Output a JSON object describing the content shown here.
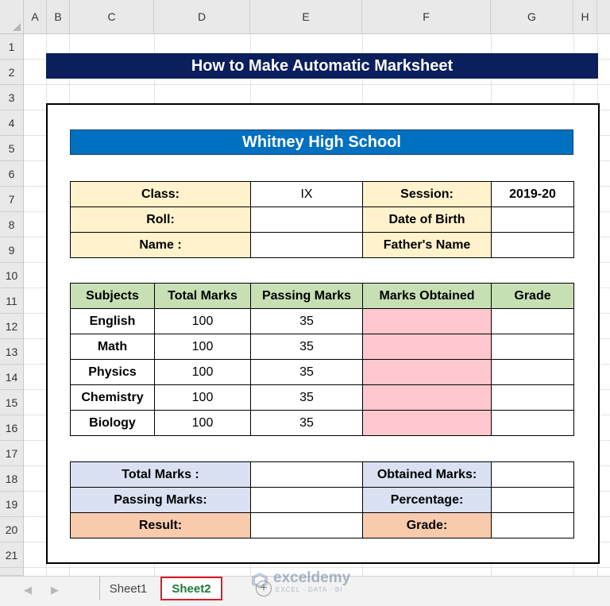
{
  "columns": [
    "A",
    "B",
    "C",
    "D",
    "E",
    "F",
    "G",
    "H"
  ],
  "rows": [
    "1",
    "2",
    "3",
    "4",
    "5",
    "6",
    "7",
    "8",
    "9",
    "10",
    "11",
    "12",
    "13",
    "14",
    "15",
    "16",
    "17",
    "18",
    "19",
    "20",
    "21"
  ],
  "title": "How to Make Automatic Marksheet",
  "school": "Whitney High School",
  "info": {
    "class_label": "Class:",
    "class_value": "IX",
    "session_label": "Session:",
    "session_value": "2019-20",
    "roll_label": "Roll:",
    "roll_value": "",
    "dob_label": "Date of Birth",
    "dob_value": "",
    "name_label": "Name :",
    "name_value": "",
    "father_label": "Father's Name",
    "father_value": ""
  },
  "marks": {
    "headers": [
      "Subjects",
      "Total Marks",
      "Passing Marks",
      "Marks Obtained",
      "Grade"
    ],
    "rows": [
      {
        "subject": "English",
        "total": "100",
        "passing": "35",
        "obtained": "",
        "grade": ""
      },
      {
        "subject": "Math",
        "total": "100",
        "passing": "35",
        "obtained": "",
        "grade": ""
      },
      {
        "subject": "Physics",
        "total": "100",
        "passing": "35",
        "obtained": "",
        "grade": ""
      },
      {
        "subject": "Chemistry",
        "total": "100",
        "passing": "35",
        "obtained": "",
        "grade": ""
      },
      {
        "subject": "Biology",
        "total": "100",
        "passing": "35",
        "obtained": "",
        "grade": ""
      }
    ]
  },
  "summary": {
    "total_label": "Total Marks :",
    "total_value": "",
    "obtained_label": "Obtained Marks:",
    "obtained_value": "",
    "passing_label": "Passing Marks:",
    "passing_value": "",
    "percentage_label": "Percentage:",
    "percentage_value": "",
    "result_label": "Result:",
    "result_value": "",
    "grade_label": "Grade:",
    "grade_value": ""
  },
  "sheets": [
    "Sheet1",
    "Sheet2"
  ],
  "active_sheet": "Sheet2",
  "watermark": {
    "name": "exceldemy",
    "tag": "EXCEL · DATA · BI"
  },
  "colors": {
    "title_bg": "#0b1f5c",
    "school_bg": "#0070c0",
    "cream": "#fff2cc",
    "green": "#c6e0b4",
    "pink": "#ffc7ce",
    "blue": "#d9e1f2",
    "orange": "#f8cbad",
    "active_tab": "#1e7a3a",
    "tab_outline": "#e01b24"
  }
}
